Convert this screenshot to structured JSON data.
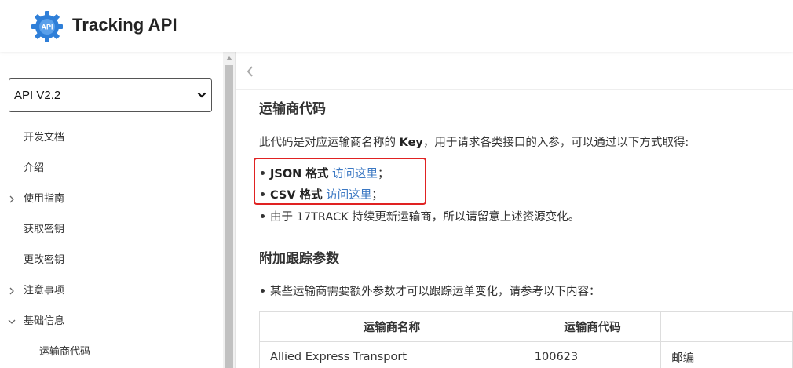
{
  "header": {
    "logo_text": "API",
    "title": "Tracking API",
    "colors": {
      "logo": "#2f7fd8",
      "accent_link": "#3b78c3",
      "highlight_border": "#e02222"
    }
  },
  "sidebar": {
    "version": "API V2.2",
    "items": [
      {
        "label": "开发文档",
        "expandable": false
      },
      {
        "label": "介绍",
        "expandable": false
      },
      {
        "label": "使用指南",
        "expandable": true,
        "expanded": false
      },
      {
        "label": "获取密钥",
        "expandable": false
      },
      {
        "label": "更改密钥",
        "expandable": false
      },
      {
        "label": "注意事项",
        "expandable": true,
        "expanded": false
      },
      {
        "label": "基础信息",
        "expandable": true,
        "expanded": true
      },
      {
        "label": "运输商代码",
        "expandable": false,
        "sub": true
      }
    ]
  },
  "content": {
    "section1_title": "运输商代码",
    "intro_prefix": "此代码是对应运输商名称的 ",
    "intro_key": "Key",
    "intro_suffix": "，用于请求各类接口的入参，可以通过以下方式取得:",
    "bullets": [
      {
        "bold": "JSON 格式",
        "link": "访问这里",
        "tail": "；"
      },
      {
        "bold": "CSV 格式",
        "link": "访问这里",
        "tail": "；"
      },
      {
        "text": "由于 17TRACK 持续更新运输商，所以请留意上述资源变化。"
      }
    ],
    "section2_title": "附加跟踪参数",
    "section2_bullet": "某些运输商需要额外参数才可以跟踪运单变化，请参考以下内容：",
    "table": {
      "headers": [
        "运输商名称",
        "运输商代码",
        ""
      ],
      "rows": [
        [
          "Allied Express Transport",
          "100623",
          "邮编"
        ]
      ]
    }
  }
}
